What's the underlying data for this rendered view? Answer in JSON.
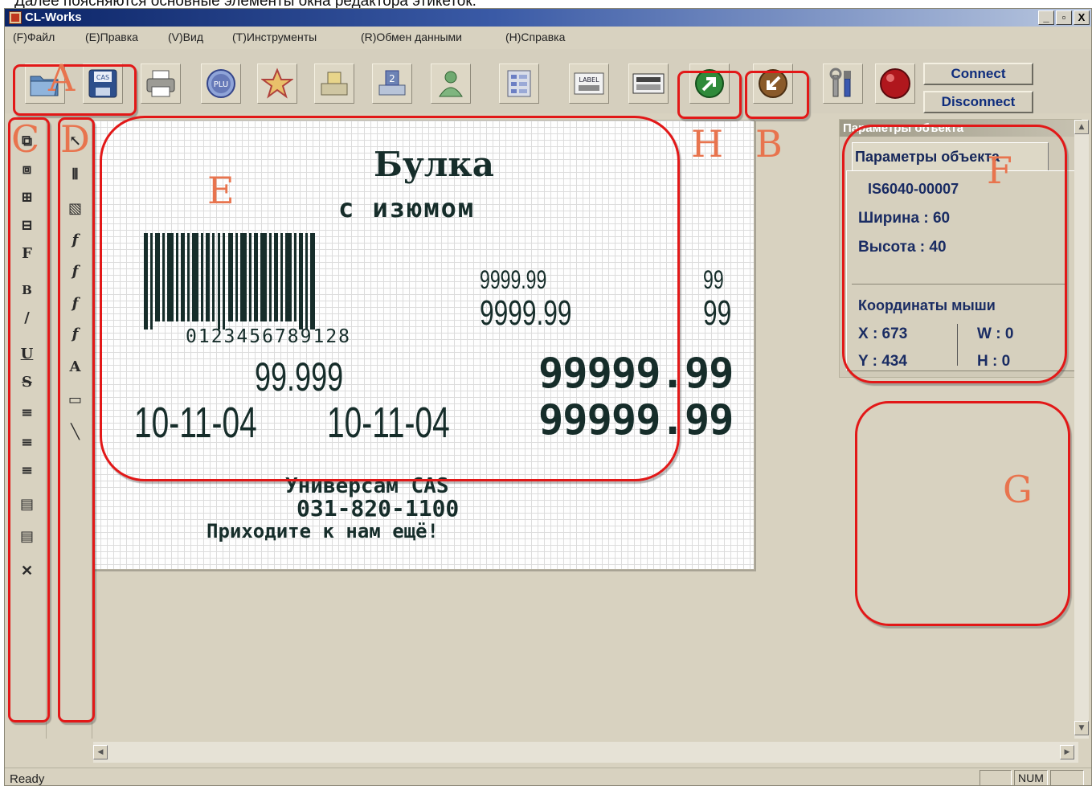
{
  "caption": "Далее поясняются основные элементы окна редактора этикеток.",
  "window": {
    "title": "CL-Works",
    "controls": [
      "_",
      "▫",
      "X"
    ]
  },
  "menu": [
    "(F)Файл",
    "(E)Правка",
    "(V)Вид",
    "(T)Инструменты",
    "(R)Обмен данными",
    "(H)Справка"
  ],
  "toolbar": {
    "icons": [
      "open-folder-icon",
      "save-disk-icon",
      "print-icon",
      "plu-icon",
      "star-icon",
      "scale-icon",
      "numbering-icon",
      "user-icon",
      "list-icon",
      "label-icon",
      "keyboard-icon",
      "send-arrow-icon",
      "receive-arrow-icon",
      "tools-icon",
      "status-led-icon"
    ],
    "small_texts": {
      "save": "CAS",
      "plu": "PLU",
      "label": "LABEL"
    },
    "connect": "Connect",
    "disconnect": "Disconnect"
  },
  "label": {
    "title": "Булка",
    "subtitle": "с изюмом",
    "barcode_digits": "0123456789128",
    "price_small": "9999.99",
    "price_small_2": "9999.99",
    "right_99": "99",
    "right_99b": "99",
    "weight": "99.999",
    "date1": "10-11-04",
    "date2": "10-11-04",
    "total1": "99999.99",
    "total2": "99999.99",
    "store": "Универсам CAS",
    "phone": "031-820-1100",
    "footer": "Приходите к нам ещё!"
  },
  "props": {
    "panel_title": "Параметры объекта",
    "tab": "Параметры объекта",
    "model": "IS6040-00007",
    "width": "Ширина : 60",
    "height": "Высота : 40",
    "mouse_title": "Координаты мыши",
    "x": "X : 673",
    "y": "Y : 434",
    "w": "W : 0",
    "h": "H : 0"
  },
  "status": {
    "text": "Ready",
    "num": "NUM"
  },
  "annotations": [
    "A",
    "B",
    "C",
    "D",
    "E",
    "F",
    "G",
    "H"
  ],
  "colors": {
    "annotation_outline": "#e21818",
    "annotation_letter": "#e8744e",
    "toolbar_text": "#0e2c7c"
  }
}
